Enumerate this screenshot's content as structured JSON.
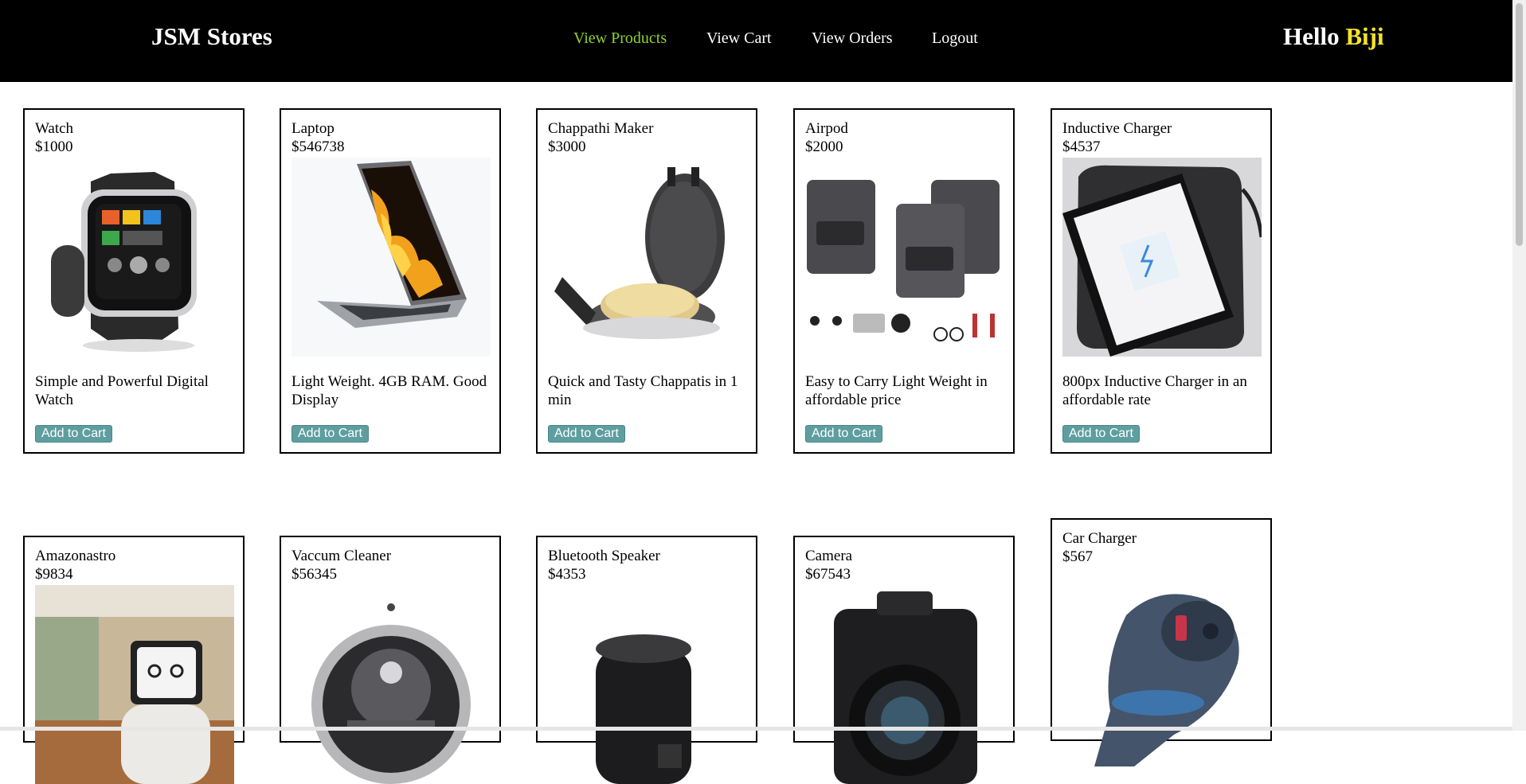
{
  "header": {
    "brand": "JSM Stores",
    "nav": [
      "View Products",
      "View Cart",
      "View Orders",
      "Logout"
    ],
    "greeting": "Hello",
    "username": "Biji"
  },
  "colors": {
    "header_bg": "#000000",
    "nav_active": "#8fd32a",
    "username": "#f5e32a",
    "button_bg": "#5f9ea0"
  },
  "products": [
    {
      "name": "Watch",
      "price": "$1000",
      "description": "Simple and Powerful Digital Watch",
      "button": "Add to Cart",
      "image": "smartwatch-image"
    },
    {
      "name": "Laptop",
      "price": "$546738",
      "description": "Light Weight. 4GB RAM. Good Display",
      "button": "Add to Cart",
      "image": "laptop-image"
    },
    {
      "name": "Chappathi Maker",
      "price": "$3000",
      "description": "Quick and Tasty Chappatis in 1 min",
      "button": "Add to Cart",
      "image": "roti-maker-image"
    },
    {
      "name": "Airpod",
      "price": "$2000",
      "description": "Easy to Carry Light Weight in affordable price",
      "button": "Add to Cart",
      "image": "wireless-mic-image"
    },
    {
      "name": "Inductive Charger",
      "price": "$4537",
      "description": "800px Inductive Charger in an affordable rate",
      "button": "Add to Cart",
      "image": "wireless-charger-image"
    },
    {
      "name": "Amazonastro",
      "price": "$9834",
      "image": "home-robot-image"
    },
    {
      "name": "Vaccum Cleaner",
      "price": "$56345",
      "image": "robot-vacuum-image"
    },
    {
      "name": "Bluetooth Speaker",
      "price": "$4353",
      "image": "speaker-image"
    },
    {
      "name": "Camera",
      "price": "$67543",
      "image": "dslr-camera-image"
    },
    {
      "name": "Car Charger",
      "price": "$567",
      "image": "car-charger-image"
    }
  ]
}
